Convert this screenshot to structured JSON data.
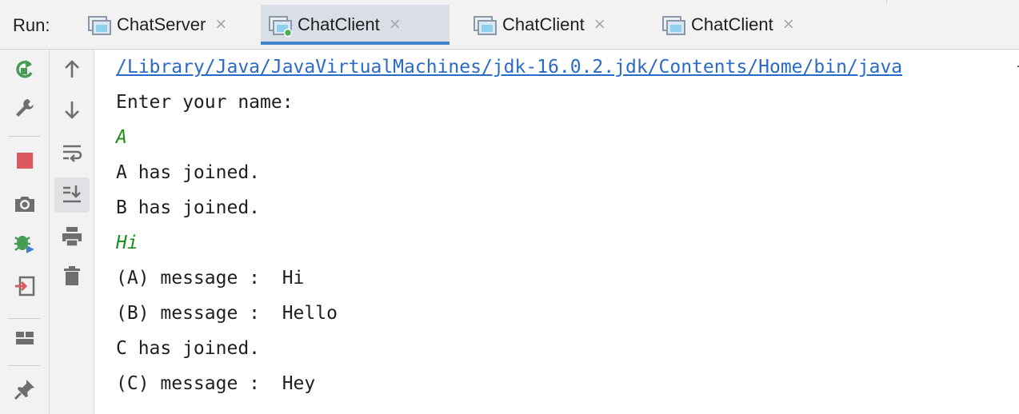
{
  "run_panel": {
    "label": "Run:",
    "tabs": [
      {
        "label": "ChatServer",
        "active": false
      },
      {
        "label": "ChatClient",
        "active": true
      },
      {
        "label": "ChatClient",
        "active": false
      },
      {
        "label": "ChatClient",
        "active": false
      }
    ],
    "close_glyph": "×"
  },
  "toolbar_left": [
    "rerun-icon",
    "wrench-icon",
    "stop-icon",
    "camera-icon",
    "debug-stop-icon",
    "exit-icon",
    "layout-icon",
    "pin-icon"
  ],
  "toolbar_right": [
    "arrow-up-icon",
    "arrow-down-icon",
    "soft-wrap-icon",
    "scroll-to-end-icon",
    "print-icon",
    "trash-icon"
  ],
  "console": {
    "lines": [
      {
        "text": "/Library/Java/JavaVirtualMachines/jdk-16.0.2.jdk/Contents/Home/bin/java",
        "kind": "link"
      },
      {
        "text": "Enter your name:",
        "kind": "output"
      },
      {
        "text": "A",
        "kind": "input"
      },
      {
        "text": "A has joined.",
        "kind": "output"
      },
      {
        "text": "B has joined.",
        "kind": "output"
      },
      {
        "text": "Hi",
        "kind": "input"
      },
      {
        "text": "(A) message :  Hi",
        "kind": "output"
      },
      {
        "text": "(B) message :  Hello",
        "kind": "output"
      },
      {
        "text": "C has joined.",
        "kind": "output"
      },
      {
        "text": "(C) message :  Hey",
        "kind": "output"
      }
    ],
    "trailing": "-"
  },
  "colors": {
    "link": "#2a6ac8",
    "user_input": "#1a8f1a",
    "active_tab_underline": "#4083c9",
    "stop_red": "#db5860",
    "run_green": "#499c54"
  }
}
